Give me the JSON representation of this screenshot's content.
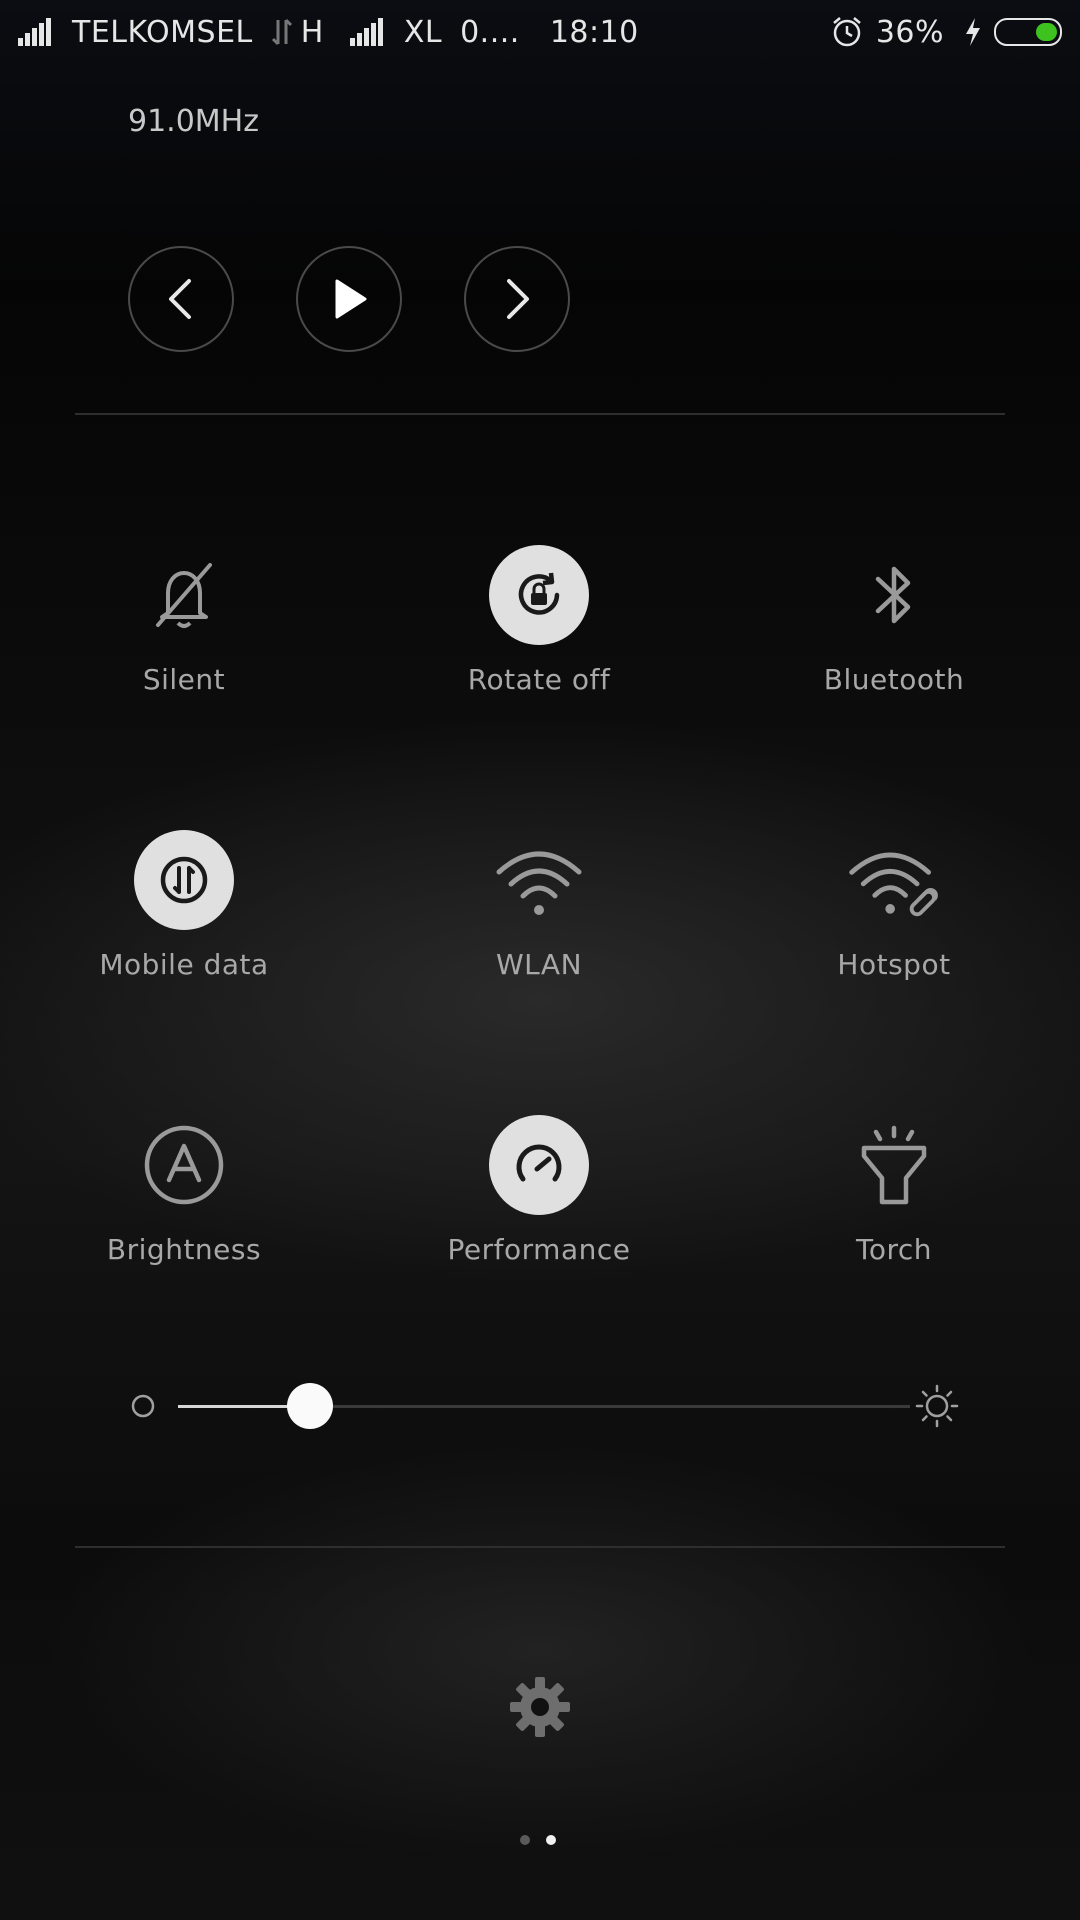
{
  "status_bar": {
    "carrier1": "TELKOMSEL",
    "network_type": "H",
    "carrier2": "XL",
    "speed": "0....",
    "time": "18:10",
    "battery_percent": "36%",
    "battery_level": 0.36,
    "battery_color": "#3ec21f"
  },
  "media": {
    "title": "91.0MHz",
    "prev_icon": "chevron-left-icon",
    "play_icon": "play-icon",
    "next_icon": "chevron-right-icon"
  },
  "toggles": [
    {
      "label": "Silent",
      "icon": "bell-off-icon",
      "active": false
    },
    {
      "label": "Rotate off",
      "icon": "rotate-lock-icon",
      "active": true
    },
    {
      "label": "Bluetooth",
      "icon": "bluetooth-icon",
      "active": false
    },
    {
      "label": "Mobile data",
      "icon": "mobile-data-icon",
      "active": true
    },
    {
      "label": "WLAN",
      "icon": "wifi-icon",
      "active": false
    },
    {
      "label": "Hotspot",
      "icon": "hotspot-icon",
      "active": false
    },
    {
      "label": "Brightness",
      "icon": "auto-brightness-icon",
      "active": false
    },
    {
      "label": "Performance",
      "icon": "speedometer-icon",
      "active": true
    },
    {
      "label": "Torch",
      "icon": "torch-icon",
      "active": false
    }
  ],
  "brightness": {
    "level": 0.18
  },
  "pager": {
    "pages": 2,
    "current": 2
  },
  "colors": {
    "active_tile_bg": "#e0e0e0",
    "label": "#a8a8a8"
  }
}
